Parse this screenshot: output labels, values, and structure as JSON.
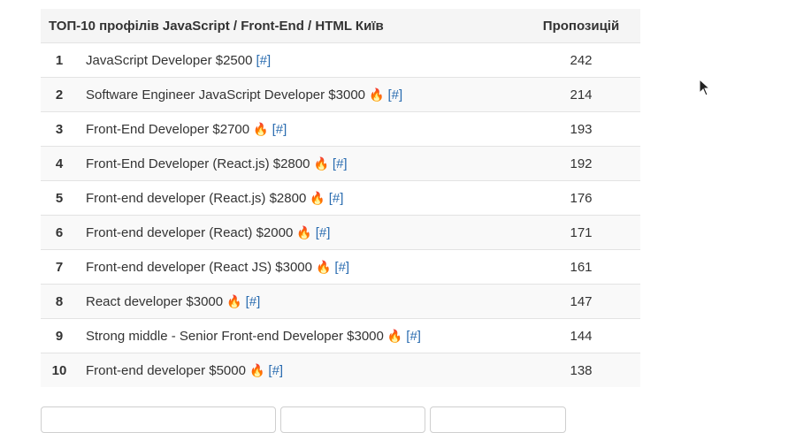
{
  "table": {
    "header_title": "ТОП-10 профілів JavaScript / Front-End / HTML Київ",
    "header_count": "Пропозицій",
    "link_label": "[#]",
    "rows": [
      {
        "rank": "1",
        "title": "JavaScript Developer $2500",
        "hot": false,
        "count": "242"
      },
      {
        "rank": "2",
        "title": "Software Engineer JavaScript Developer $3000",
        "hot": true,
        "count": "214"
      },
      {
        "rank": "3",
        "title": "Front-End Developer $2700",
        "hot": true,
        "count": "193"
      },
      {
        "rank": "4",
        "title": "Front-End Developer (React.js) $2800",
        "hot": true,
        "count": "192"
      },
      {
        "rank": "5",
        "title": "Front-end developer (React.js) $2800",
        "hot": true,
        "count": "176"
      },
      {
        "rank": "6",
        "title": "Front-end developer (React) $2000",
        "hot": true,
        "count": "171"
      },
      {
        "rank": "7",
        "title": "Front-end developer (React JS) $3000",
        "hot": true,
        "count": "161"
      },
      {
        "rank": "8",
        "title": "React developer $3000",
        "hot": true,
        "count": "147"
      },
      {
        "rank": "9",
        "title": "Strong middle - Senior Front-end Developer $3000",
        "hot": true,
        "count": "144"
      },
      {
        "rank": "10",
        "title": "Front-end developer $5000",
        "hot": true,
        "count": "138"
      }
    ]
  },
  "icons": {
    "hot": "fire-icon",
    "pointer": "mouse-cursor-icon"
  },
  "colors": {
    "link": "#2a6cb0",
    "header_bg": "#f5f5f5",
    "stripe_bg": "#f9f9f9"
  }
}
